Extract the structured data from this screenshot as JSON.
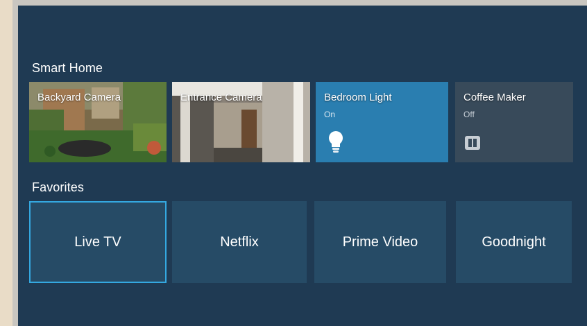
{
  "smart_home": {
    "title": "Smart Home",
    "tiles": [
      {
        "label": "Backyard Camera",
        "icon": "camera-feed"
      },
      {
        "label": "Entrance Camera",
        "icon": "camera-feed"
      },
      {
        "label": "Bedroom Light",
        "status": "On",
        "icon": "lightbulb-icon",
        "color": "#2a7eb0"
      },
      {
        "label": "Coffee Maker",
        "status": "Off",
        "icon": "pause-icon",
        "color": "#384a5a"
      }
    ]
  },
  "favorites": {
    "title": "Favorites",
    "items": [
      {
        "label": "Live TV",
        "selected": true
      },
      {
        "label": "Netflix"
      },
      {
        "label": "Prime Video"
      },
      {
        "label": "Goodnight"
      }
    ]
  },
  "colors": {
    "background": "#1f3a53",
    "tile": "#264b66",
    "focus": "#34a8e0"
  }
}
